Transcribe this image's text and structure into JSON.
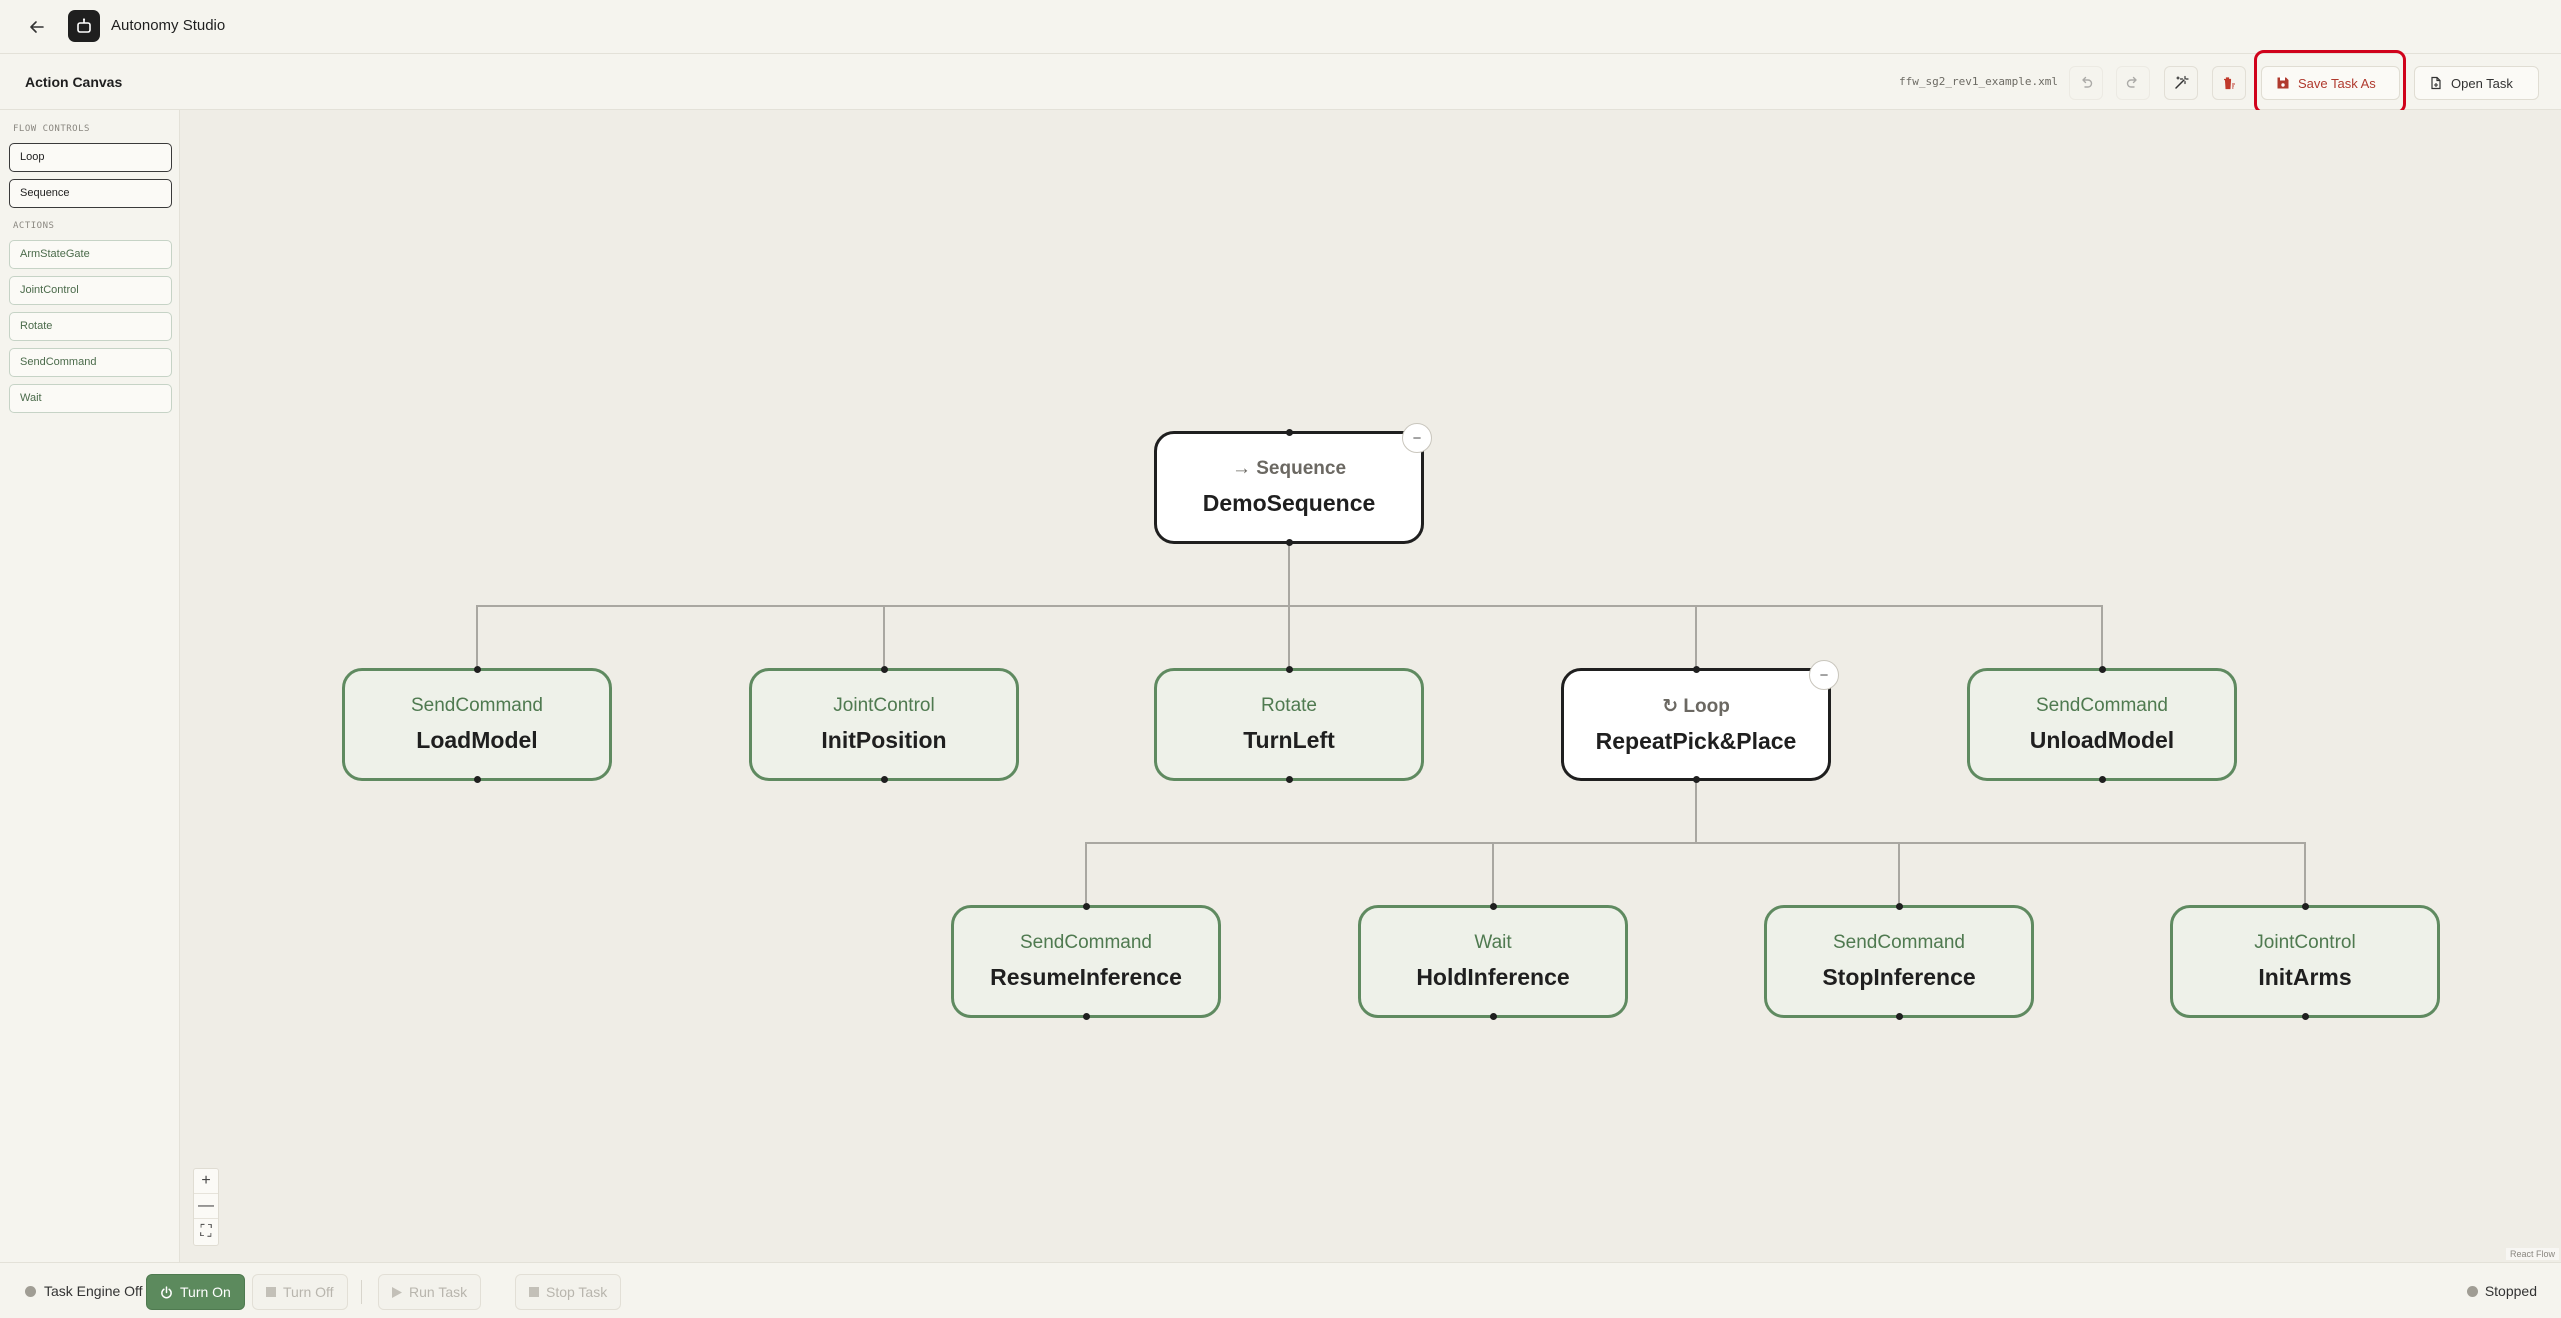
{
  "app": {
    "title": "Autonomy Studio"
  },
  "toolbar": {
    "title": "Action Canvas",
    "filename": "ffw_sg2_rev1_example.xml",
    "save_label": "Save Task As",
    "open_label": "Open Task"
  },
  "sidebar": {
    "flow_heading": "FLOW CONTROLS",
    "flow_items": [
      "Loop",
      "Sequence"
    ],
    "actions_heading": "ACTIONS",
    "action_items": [
      "ArmStateGate",
      "JointControl",
      "Rotate",
      "SendCommand",
      "Wait"
    ]
  },
  "tree": {
    "root": {
      "type": "→ Sequence",
      "name": "DemoSequence",
      "collapse": "−"
    },
    "level1": [
      {
        "type": "SendCommand",
        "name": "LoadModel"
      },
      {
        "type": "JointControl",
        "name": "InitPosition"
      },
      {
        "type": "Rotate",
        "name": "TurnLeft"
      },
      {
        "type": "↻ Loop",
        "name": "RepeatPick&Place",
        "collapse": "−"
      },
      {
        "type": "SendCommand",
        "name": "UnloadModel"
      }
    ],
    "level2": [
      {
        "type": "SendCommand",
        "name": "ResumeInference"
      },
      {
        "type": "Wait",
        "name": "HoldInference"
      },
      {
        "type": "SendCommand",
        "name": "StopInference"
      },
      {
        "type": "JointControl",
        "name": "InitArms"
      }
    ]
  },
  "zoom": {
    "in": "+",
    "out": "—",
    "fit": "⛶"
  },
  "attribution": "React Flow",
  "bottombar": {
    "engine_status": "Task Engine Off",
    "turn_on": "Turn On",
    "turn_off": "Turn Off",
    "run_task": "Run Task",
    "stop_task": "Stop Task",
    "run_status": "Stopped"
  },
  "colors": {
    "accent_green": "#5c8a5d",
    "save_red": "#b03a2e",
    "highlight_red": "#d0021b"
  }
}
